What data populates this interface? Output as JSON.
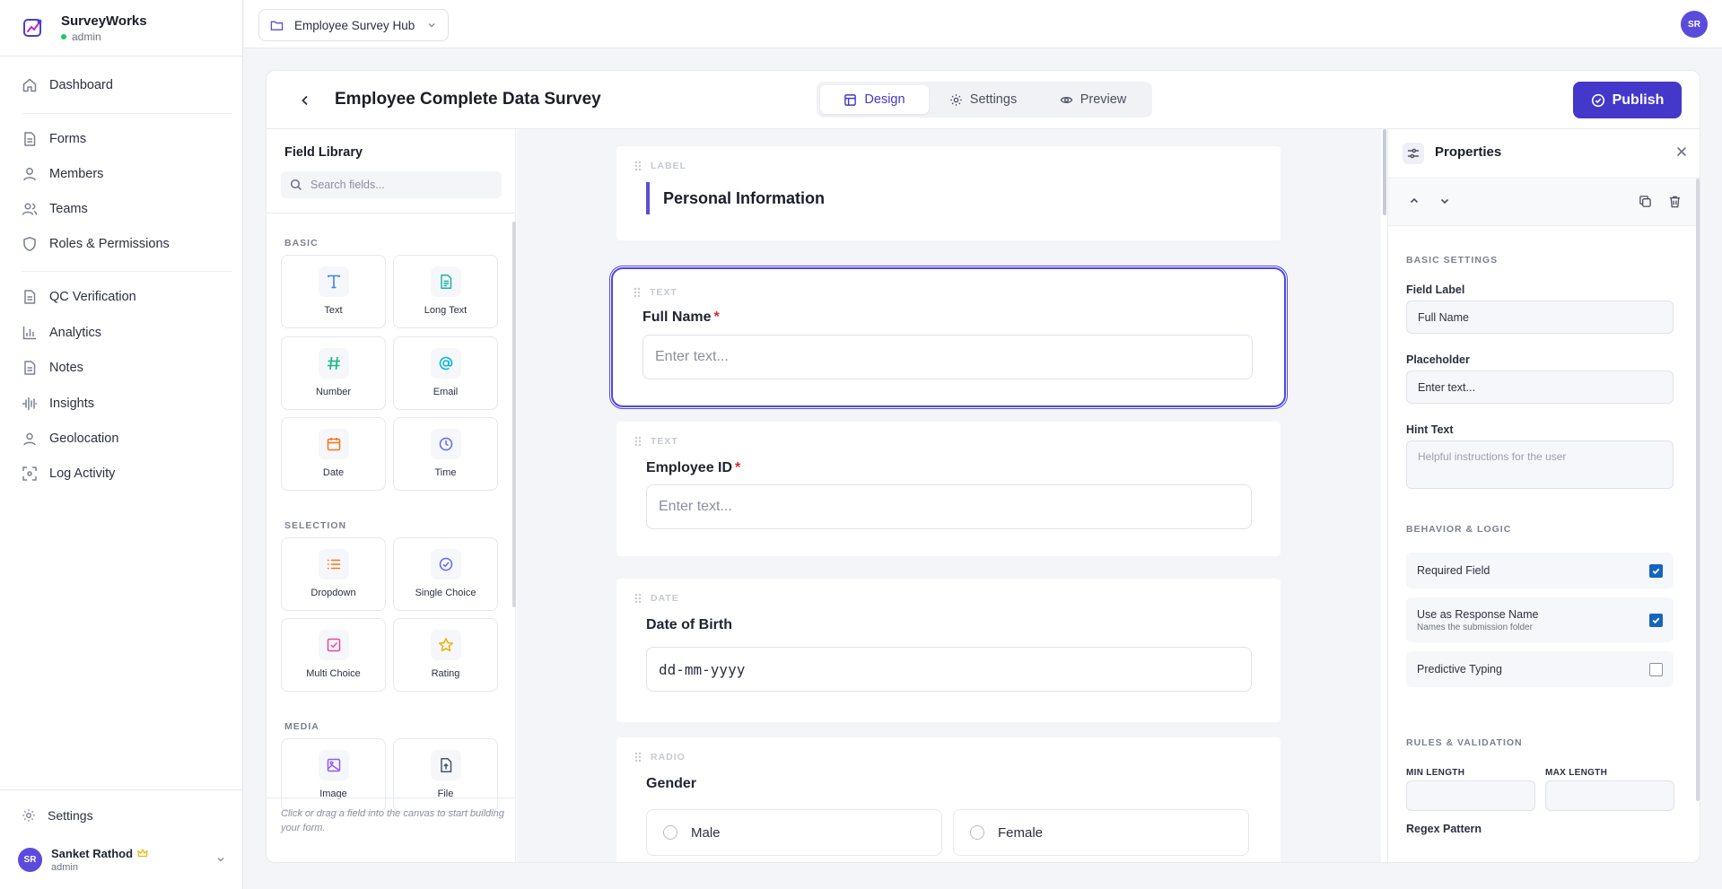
{
  "app": {
    "name": "SurveyWorks",
    "role": "admin"
  },
  "nav": {
    "dashboard": "Dashboard",
    "forms": "Forms",
    "members": "Members",
    "teams": "Teams",
    "roles": "Roles & Permissions",
    "qc": "QC Verification",
    "analytics": "Analytics",
    "notes": "Notes",
    "insights": "Insights",
    "geolocation": "Geolocation",
    "log_activity": "Log Activity",
    "settings": "Settings"
  },
  "user": {
    "initials": "SR",
    "name": "Sanket Rathod",
    "role": "admin"
  },
  "topbar": {
    "workspace": "Employee Survey Hub",
    "avatar_initials": "SR"
  },
  "header": {
    "title": "Employee Complete Data Survey",
    "tabs": {
      "design": "Design",
      "settings": "Settings",
      "preview": "Preview"
    },
    "publish": "Publish"
  },
  "library": {
    "title": "Field Library",
    "search_placeholder": "Search fields...",
    "sections": {
      "basic": "BASIC",
      "selection": "SELECTION",
      "media": "MEDIA"
    },
    "tiles": {
      "text": "Text",
      "long_text": "Long Text",
      "number": "Number",
      "email": "Email",
      "date": "Date",
      "time": "Time",
      "dropdown": "Dropdown",
      "single_choice": "Single Choice",
      "multi_choice": "Multi Choice",
      "rating": "Rating",
      "image": "Image",
      "file": "File"
    },
    "footer": "Click or drag a field into the canvas to start building your form."
  },
  "canvas": {
    "section": {
      "type": "LABEL",
      "title": "Personal Information"
    },
    "full_name": {
      "type": "TEXT",
      "label": "Full Name",
      "required": "*",
      "placeholder": "Enter text..."
    },
    "employee_id": {
      "type": "TEXT",
      "label": "Employee ID",
      "required": "*",
      "placeholder": "Enter text..."
    },
    "dob": {
      "type": "DATE",
      "label": "Date of Birth",
      "placeholder": "dd-mm-yyyy"
    },
    "gender": {
      "type": "RADIO",
      "label": "Gender",
      "options": [
        "Male",
        "Female"
      ]
    }
  },
  "properties": {
    "title": "Properties",
    "basic_settings": "BASIC SETTINGS",
    "field_label_label": "Field Label",
    "field_label_value": "Full Name",
    "placeholder_label": "Placeholder",
    "placeholder_value": "Enter text...",
    "hint_label": "Hint Text",
    "hint_placeholder": "Helpful instructions for the user",
    "behavior": "BEHAVIOR & LOGIC",
    "required": {
      "label": "Required Field",
      "checked": true
    },
    "response_name": {
      "label": "Use as Response Name",
      "sub": "Names the submission folder",
      "checked": true
    },
    "predictive": {
      "label": "Predictive Typing",
      "checked": false
    },
    "rules": "RULES & VALIDATION",
    "min_length": "MIN LENGTH",
    "max_length": "MAX LENGTH",
    "regex": "Regex Pattern"
  },
  "colors": {
    "accent": "#4338ca",
    "brand_purple": "#5b4bdc",
    "checkbox_blue": "#1565c0",
    "required_red": "#dc2626"
  }
}
